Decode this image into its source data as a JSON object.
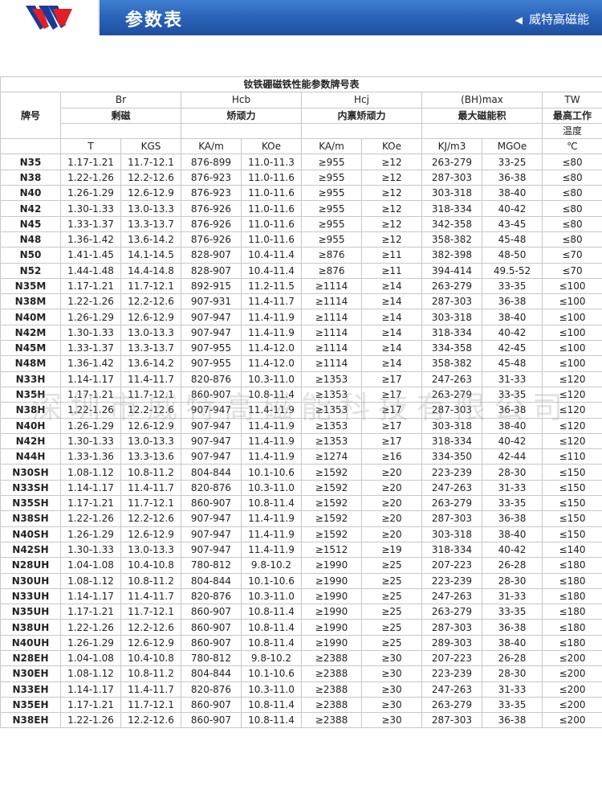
{
  "header": {
    "title": "参数表",
    "company": "威特高磁能",
    "colors": {
      "bar": "#2a62b8",
      "logo_red": "#e21f26",
      "logo_blue": "#1a3a9a"
    }
  },
  "table": {
    "title": "钕铁硼磁铁性能参数牌号表",
    "grade_label": "牌号",
    "groups": [
      {
        "sym": "Br",
        "cn": "剩磁"
      },
      {
        "sym": "Hcb",
        "cn": "矫顽力"
      },
      {
        "sym": "Hcj",
        "cn": "内禀矫顽力"
      },
      {
        "sym": "(BH)max",
        "cn": "最大磁能积"
      },
      {
        "sym": "TW",
        "cn": "最高工作"
      }
    ],
    "temp_label": "温度",
    "units": [
      "T",
      "KGS",
      "KA/m",
      "KOe",
      "KA/m",
      "KOe",
      "KJ/m3",
      "MGOe",
      "℃"
    ],
    "rows": [
      [
        "N35",
        "1.17-1.21",
        "11.7-12.1",
        "876-899",
        "11.0-11.3",
        "≥955",
        "≥12",
        "263-279",
        "33-25",
        "≤80"
      ],
      [
        "N38",
        "1.22-1.26",
        "12.2-12.6",
        "876-923",
        "11.0-11.6",
        "≥955",
        "≥12",
        "287-303",
        "36-38",
        "≤80"
      ],
      [
        "N40",
        "1.26-1.29",
        "12.6-12.9",
        "876-923",
        "11.0-11.6",
        "≥955",
        "≥12",
        "303-318",
        "38-40",
        "≤80"
      ],
      [
        "N42",
        "1.30-1.33",
        "13.0-13.3",
        "876-926",
        "11.0-11.6",
        "≥955",
        "≥12",
        "318-334",
        "40-42",
        "≤80"
      ],
      [
        "N45",
        "1.33-1.37",
        "13.3-13.7",
        "876-926",
        "11.0-11.6",
        "≥955",
        "≥12",
        "342-358",
        "43-45",
        "≤80"
      ],
      [
        "N48",
        "1.36-1.42",
        "13.6-14.2",
        "876-926",
        "11.0-11.6",
        "≥955",
        "≥12",
        "358-382",
        "45-48",
        "≤80"
      ],
      [
        "N50",
        "1.41-1.45",
        "14.1-14.5",
        "828-907",
        "10.4-11.4",
        "≥876",
        "≥11",
        "382-398",
        "48-50",
        "≤70"
      ],
      [
        "N52",
        "1.44-1.48",
        "14.4-14.8",
        "828-907",
        "10.4-11.4",
        "≥876",
        "≥11",
        "394-414",
        "49.5-52",
        "≤70"
      ],
      [
        "N35M",
        "1.17-1.21",
        "11.7-12.1",
        "892-915",
        "11.2-11.5",
        "≥1114",
        "≥14",
        "263-279",
        "33-35",
        "≤100"
      ],
      [
        "N38M",
        "1.22-1.26",
        "12.2-12.6",
        "907-931",
        "11.4-11.7",
        "≥1114",
        "≥14",
        "287-303",
        "36-38",
        "≤100"
      ],
      [
        "N40M",
        "1.26-1.29",
        "12.6-12.9",
        "907-947",
        "11.4-11.9",
        "≥1114",
        "≥14",
        "303-318",
        "38-40",
        "≤100"
      ],
      [
        "N42M",
        "1.30-1.33",
        "13.0-13.3",
        "907-947",
        "11.4-11.9",
        "≥1114",
        "≥14",
        "318-334",
        "40-42",
        "≤100"
      ],
      [
        "N45M",
        "1.33-1.37",
        "13.3-13.7",
        "907-955",
        "11.4-12.0",
        "≥1114",
        "≥14",
        "334-358",
        "42-45",
        "≤100"
      ],
      [
        "N48M",
        "1.36-1.42",
        "13.6-14.2",
        "907-955",
        "11.4-12.0",
        "≥1114",
        "≥14",
        "358-382",
        "45-48",
        "≤100"
      ],
      [
        "N33H",
        "1.14-1.17",
        "11.4-11.7",
        "820-876",
        "10.3-11.0",
        "≥1353",
        "≥17",
        "247-263",
        "31-33",
        "≤120"
      ],
      [
        "N35H",
        "1.17-1.21",
        "11.7-12.1",
        "860-907",
        "10.8-11.4",
        "≥1353",
        "≥17",
        "263-279",
        "33-35",
        "≤120"
      ],
      [
        "N38H",
        "1.22-1.26",
        "12.2-12.6",
        "907-947",
        "11.4-11.9",
        "≥1353",
        "≥17",
        "287-303",
        "36-38",
        "≤120"
      ],
      [
        "N40H",
        "1.26-1.29",
        "12.6-12.9",
        "907-947",
        "11.4-11.9",
        "≥1353",
        "≥17",
        "303-318",
        "38-40",
        "≤120"
      ],
      [
        "N42H",
        "1.30-1.33",
        "13.0-13.3",
        "907-947",
        "11.4-11.9",
        "≥1353",
        "≥17",
        "318-334",
        "40-42",
        "≤120"
      ],
      [
        "N44H",
        "1.33-1.36",
        "13.3-13.6",
        "907-947",
        "11.4-11.9",
        "≥1274",
        "≥16",
        "334-350",
        "42-44",
        "≤110"
      ],
      [
        "N30SH",
        "1.08-1.12",
        "10.8-11.2",
        "804-844",
        "10.1-10.6",
        "≥1592",
        "≥20",
        "223-239",
        "28-30",
        "≤150"
      ],
      [
        "N33SH",
        "1.14-1.17",
        "11.4-11.7",
        "820-876",
        "10.3-11.0",
        "≥1592",
        "≥20",
        "247-263",
        "31-33",
        "≤150"
      ],
      [
        "N35SH",
        "1.17-1.21",
        "11.7-12.1",
        "860-907",
        "10.8-11.4",
        "≥1592",
        "≥20",
        "263-279",
        "33-35",
        "≤150"
      ],
      [
        "N38SH",
        "1.22-1.26",
        "12.2-12.6",
        "907-947",
        "11.4-11.9",
        "≥1592",
        "≥20",
        "287-303",
        "36-38",
        "≤150"
      ],
      [
        "N40SH",
        "1.26-1.29",
        "12.6-12.9",
        "907-947",
        "11.4-11.9",
        "≥1592",
        "≥20",
        "303-318",
        "38-40",
        "≤150"
      ],
      [
        "N42SH",
        "1.30-1.33",
        "13.0-13.3",
        "907-947",
        "11.4-11.9",
        "≥1512",
        "≥19",
        "318-334",
        "40-42",
        "≤140"
      ],
      [
        "N28UH",
        "1.04-1.08",
        "10.4-10.8",
        "780-812",
        "9.8-10.2",
        "≥1990",
        "≥25",
        "207-223",
        "26-28",
        "≤180"
      ],
      [
        "N30UH",
        "1.08-1.12",
        "10.8-11.2",
        "804-844",
        "10.1-10.6",
        "≥1990",
        "≥25",
        "223-239",
        "28-30",
        "≤180"
      ],
      [
        "N33UH",
        "1.14-1.17",
        "11.4-11.7",
        "820-876",
        "10.3-11.0",
        "≥1990",
        "≥25",
        "247-263",
        "31-33",
        "≤180"
      ],
      [
        "N35UH",
        "1.17-1.21",
        "11.7-12.1",
        "860-907",
        "10.8-11.4",
        "≥1990",
        "≥25",
        "263-279",
        "33-35",
        "≤180"
      ],
      [
        "N38UH",
        "1.22-1.26",
        "12.2-12.6",
        "860-907",
        "10.8-11.4",
        "≥1990",
        "≥25",
        "287-303",
        "36-38",
        "≤180"
      ],
      [
        "N40UH",
        "1.26-1.29",
        "12.6-12.9",
        "860-907",
        "10.8-11.4",
        "≥1990",
        "≥25",
        "289-303",
        "38-40",
        "≤180"
      ],
      [
        "N28EH",
        "1.04-1.08",
        "10.4-10.8",
        "780-812",
        "9.8-10.2",
        "≥2388",
        "≥30",
        "207-223",
        "26-28",
        "≤200"
      ],
      [
        "N30EH",
        "1.08-1.12",
        "10.8-11.2",
        "804-844",
        "10.1-10.6",
        "≥2388",
        "≥30",
        "223-239",
        "28-30",
        "≤200"
      ],
      [
        "N33EH",
        "1.14-1.17",
        "11.4-11.7",
        "820-876",
        "10.3-11.0",
        "≥2388",
        "≥30",
        "247-263",
        "31-33",
        "≤200"
      ],
      [
        "N35EH",
        "1.17-1.21",
        "11.7-12.1",
        "860-907",
        "10.8-11.4",
        "≥2388",
        "≥30",
        "263-279",
        "33-35",
        "≤200"
      ],
      [
        "N38EH",
        "1.22-1.26",
        "12.2-12.6",
        "860-907",
        "10.8-11.4",
        "≥2388",
        "≥30",
        "287-303",
        "36-38",
        "≤200"
      ]
    ]
  },
  "watermark": "深圳市威特高磁能科技有限公司"
}
